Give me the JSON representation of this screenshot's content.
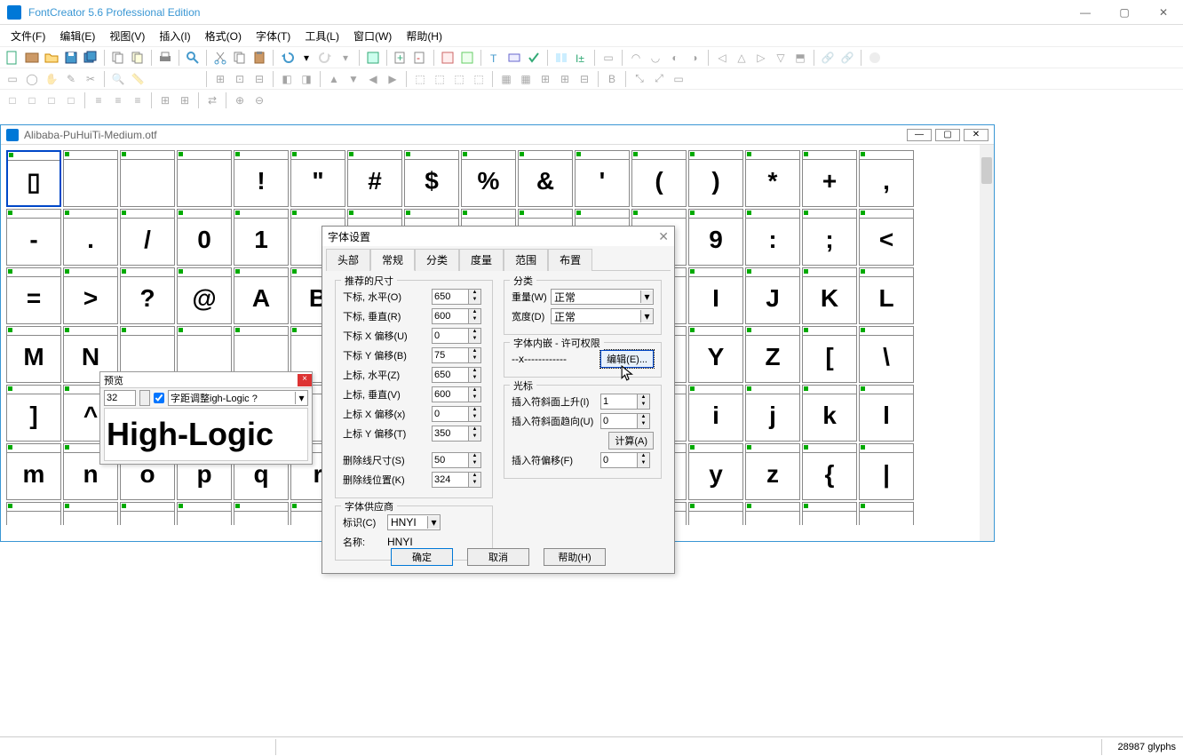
{
  "app": {
    "title": "FontCreator 5.6 Professional Edition"
  },
  "menu": {
    "file": "文件(F)",
    "edit": "编辑(E)",
    "view": "视图(V)",
    "insert": "插入(I)",
    "format": "格式(O)",
    "font": "字体(T)",
    "tool": "工具(L)",
    "window": "窗口(W)",
    "help": "帮助(H)"
  },
  "child_window": {
    "title": "Alibaba-PuHuiTi-Medium.otf"
  },
  "glyph_rows": [
    [
      "▯",
      "",
      "",
      "",
      "!",
      "\"",
      "#",
      "$",
      "%",
      "&",
      "'",
      "(",
      ")",
      "*",
      "+",
      ","
    ],
    [
      "-",
      ".",
      "/",
      "0",
      "1",
      "",
      "",
      "",
      "",
      "",
      "",
      "",
      "9",
      ":",
      ";",
      "<"
    ],
    [
      "=",
      ">",
      "?",
      "@",
      "A",
      "B",
      "",
      "",
      "",
      "",
      "",
      "",
      "I",
      "J",
      "K",
      "L"
    ],
    [
      "M",
      "N",
      "",
      "",
      "",
      "",
      "",
      "",
      "",
      "",
      "",
      "",
      "Y",
      "Z",
      "[",
      "\\"
    ],
    [
      "]",
      "^",
      "",
      "",
      "",
      "",
      "",
      "",
      "",
      "",
      "",
      "",
      "i",
      "j",
      "k",
      "l"
    ],
    [
      "m",
      "n",
      "o",
      "p",
      "q",
      "r",
      "",
      "",
      "",
      "",
      "",
      "",
      "y",
      "z",
      "{",
      "|"
    ],
    [
      "",
      "",
      "",
      "",
      "",
      "",
      "",
      "",
      "",
      "",
      "",
      "",
      "",
      "",
      "",
      ""
    ]
  ],
  "preview": {
    "title": "预览",
    "size": "32",
    "kerning_label": "字距调整igh-Logic ?",
    "sample": "High-Logic"
  },
  "dialog": {
    "title": "字体设置",
    "tabs": {
      "head": "头部",
      "general": "常规",
      "classify": "分类",
      "metric": "度量",
      "range": "范围",
      "layout": "布置"
    },
    "sec_size": "推荐的尺寸",
    "sub_h": "下标, 水平(O)",
    "sub_h_v": "650",
    "sub_v": "下标, 垂直(R)",
    "sub_v_v": "600",
    "sub_xoff": "下标 X 偏移(U)",
    "sub_xoff_v": "0",
    "sub_yoff": "下标 Y 偏移(B)",
    "sub_yoff_v": "75",
    "sup_h": "上标, 水平(Z)",
    "sup_h_v": "650",
    "sup_v": "上标, 垂直(V)",
    "sup_v_v": "600",
    "sup_xoff": "上标 X 偏移(x)",
    "sup_xoff_v": "0",
    "sup_yoff": "上标 Y 偏移(T)",
    "sup_yoff_v": "350",
    "strike_size": "删除线尺寸(S)",
    "strike_size_v": "50",
    "strike_pos": "删除线位置(K)",
    "strike_pos_v": "324",
    "sec_class": "分类",
    "weight_l": "重量(W)",
    "weight_v": "正常",
    "width_l": "宽度(D)",
    "width_v": "正常",
    "sec_embed": "字体内嵌 - 许可权限",
    "embed_val": "--x------------",
    "edit_btn": "编辑(E)...",
    "sec_cursor": "光标",
    "caret_rise": "插入符斜面上升(I)",
    "caret_rise_v": "1",
    "caret_run": "插入符斜面趋向(U)",
    "caret_run_v": "0",
    "calc_btn": "计算(A)",
    "caret_off": "插入符偏移(F)",
    "caret_off_v": "0",
    "sec_vendor": "字体供应商",
    "vendor_id_l": "标识(C)",
    "vendor_id_v": "HNYI",
    "vendor_name_l": "名称:",
    "vendor_name_v": "HNYI",
    "ok": "确定",
    "cancel": "取消",
    "help": "帮助(H)"
  },
  "status": {
    "glyphs": "28987 glyphs"
  }
}
